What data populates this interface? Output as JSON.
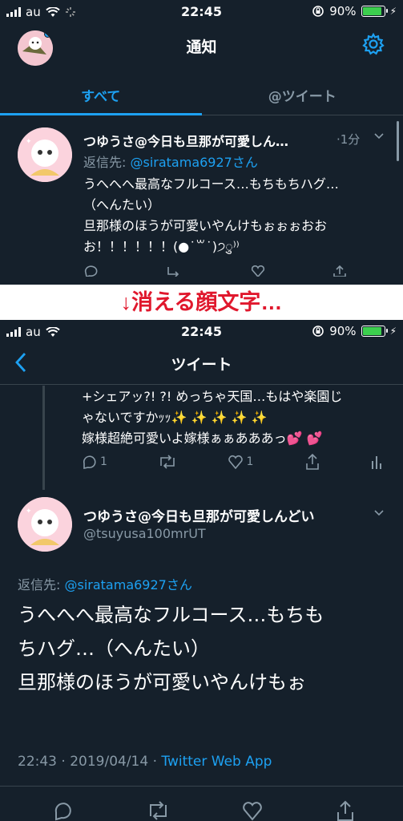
{
  "status_top": {
    "carrier": "au",
    "time": "22:45",
    "battery": "90%"
  },
  "notifications": {
    "title": "通知",
    "tabs": [
      "すべて",
      "@ツイート"
    ],
    "item": {
      "name": "つゆうさ@今日も旦那が可愛しん…",
      "time": "·1分",
      "reply_prefix": "返信先: ",
      "reply_handle": "@siratama6927さん",
      "lines": [
        "うへへへ最高なフルコース…もちもちハグ…",
        "（へんたい）",
        "旦那様のほうが可愛いやんけもぉぉぉおお",
        "お！！！！！！(●˙꒳˙)੭ु⁾⁾"
      ]
    }
  },
  "banner": {
    "text": "↓消える顔文字…"
  },
  "status_bottom": {
    "carrier": "au",
    "time": "22:45",
    "battery": "90%"
  },
  "tweet_page": {
    "title": "ツイート",
    "previous": {
      "lines": [
        "+シェアッ?! ?! めっちゃ天国…もはや楽園じ",
        "ゃないですかｯｯ✨ ✨ ✨ ✨ ✨",
        "嫁様超絶可愛いよ嫁様ぁぁあああっ💕 💕"
      ],
      "reply_count": "1",
      "like_count": "1"
    },
    "main": {
      "name": "つゆうさ@今日も旦那が可愛しんどい",
      "handle": "@tsuyusa100mrUT",
      "reply_prefix": "返信先: ",
      "reply_handle": "@siratama6927さん",
      "lines": [
        "うへへへ最高なフルコース…もちも",
        "ちハグ…（へんたい）",
        "旦那様のほうが可愛いやんけもぉ"
      ],
      "timestamp": "22:43 · 2019/04/14 · ",
      "source": "Twitter Web App"
    }
  },
  "colors": {
    "background": "#15202b",
    "accent": "#1da1f2",
    "muted": "#8899a6",
    "banner_text": "#e0182d"
  }
}
